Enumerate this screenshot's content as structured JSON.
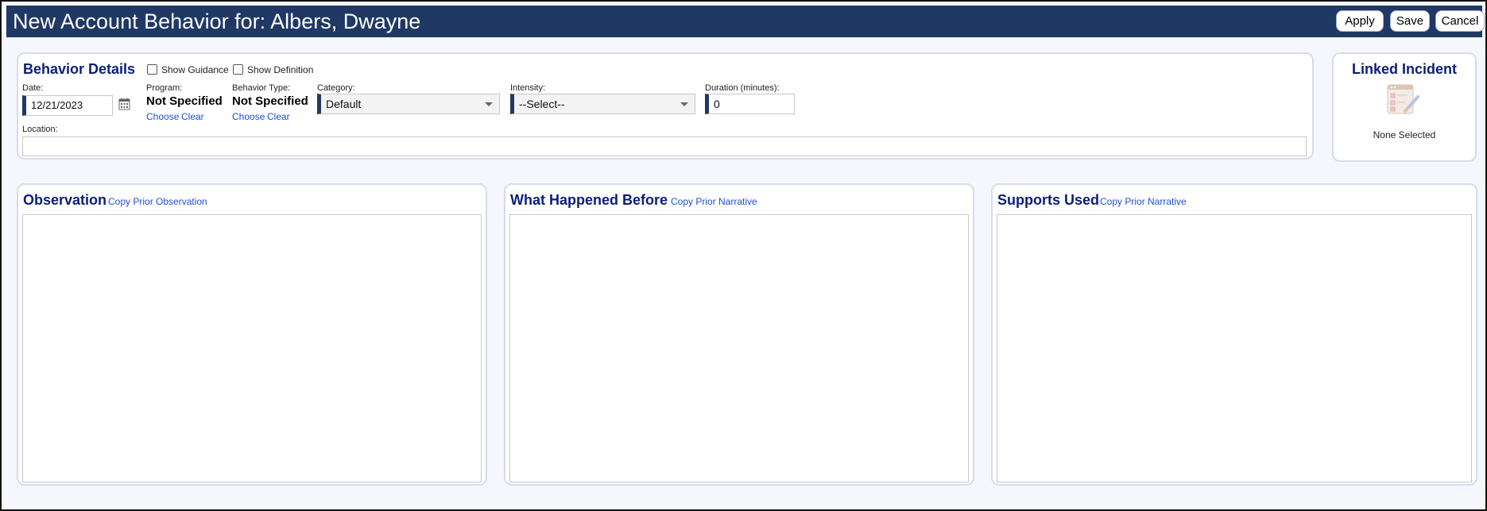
{
  "header": {
    "title": "New Account Behavior for: Albers, Dwayne",
    "apply_label": "Apply",
    "save_label": "Save",
    "cancel_label": "Cancel"
  },
  "details": {
    "title": "Behavior Details",
    "show_guidance_label": "Show Guidance",
    "show_definition_label": "Show Definition",
    "date_label": "Date:",
    "date_value": "12/21/2023",
    "program_label": "Program:",
    "program_value": "Not Specified",
    "program_choose": "Choose",
    "program_clear": "Clear",
    "behavior_type_label": "Behavior Type:",
    "behavior_type_value": "Not Specified",
    "behavior_choose": "Choose",
    "behavior_clear": "Clear",
    "category_label": "Category:",
    "category_value": "Default",
    "intensity_label": "Intensity:",
    "intensity_value": "--Select--",
    "duration_label": "Duration (minutes):",
    "duration_value": "0",
    "location_label": "Location:",
    "location_value": ""
  },
  "linked_incident": {
    "title": "Linked Incident",
    "status": "None Selected",
    "icon": "incident-report-icon"
  },
  "observation": {
    "title": "Observation",
    "copy_link": "Copy Prior Observation"
  },
  "what_happened_before": {
    "title": "What Happened Before",
    "copy_link": "Copy Prior Narrative"
  },
  "supports_used": {
    "title": "Supports Used",
    "copy_link": "Copy Prior Narrative"
  },
  "colors": {
    "header_bg": "#1f3864",
    "title_text": "#0a1e78",
    "link": "#1f4fd8"
  }
}
